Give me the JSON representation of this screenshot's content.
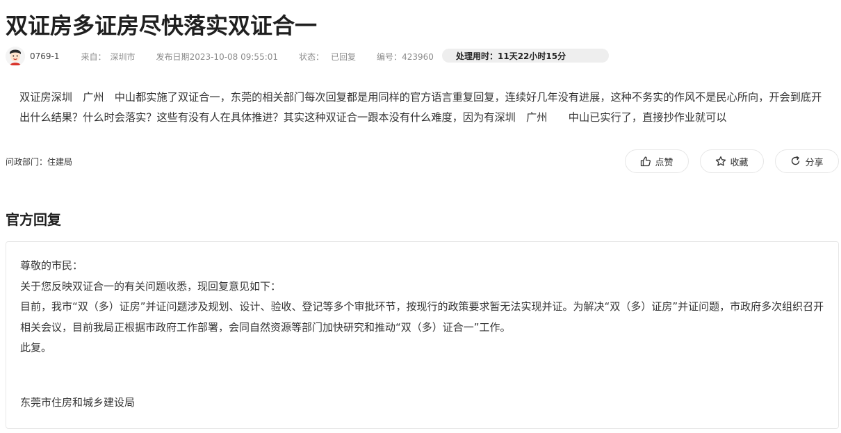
{
  "post": {
    "title": "双证房多证房尽快落实双证合一",
    "user": "0769-1",
    "source_label": "来自：",
    "source_value": "深圳市",
    "date_label": "发布日期",
    "date_value": "2023-10-08 09:55:01",
    "status_label": "状态：",
    "status_value": "已回复",
    "id_label": "编号：",
    "id_value": "423960",
    "processing_time": "处理用时：11天22小时15分",
    "content": "双证房深圳　广州　中山都实施了双证合一，东莞的相关部门每次回复都是用同样的官方语言重复回复，连续好几年没有进展，这种不务实的作风不是民心所向，开会到底开出什么结果？什么时会落实？这些有没有人在具体推进？其实这种双证合一跟本没有什么难度，因为有深圳　广州　　中山已实行了，直接抄作业就可以",
    "department": "问政部门：住建局"
  },
  "actions": {
    "like_label": "点赞",
    "favorite_label": "收藏",
    "share_label": "分享"
  },
  "reply": {
    "heading": "官方回复",
    "greeting": "尊敬的市民：",
    "intro": "关于您反映双证合一的有关问题收悉，现回复意见如下：",
    "body": "目前，我市“双（多）证房”并证问题涉及规划、设计、验收、登记等多个审批环节，按现行的政策要求暂无法实现并证。为解决“双（多）证房”并证问题，市政府多次组织召开相关会议，目前我局正根据市政府工作部署，会同自然资源等部门加快研究和推动“双（多）证合一”工作。",
    "closing": "此复。",
    "signature": "东莞市住房和城乡建设局"
  },
  "icons": {
    "avatar": "avatar-icon",
    "like": "thumbs-up-icon",
    "favorite": "star-icon",
    "share": "share-icon"
  },
  "colors": {
    "title": "#1f1f1f",
    "meta_text": "#8c8c8c",
    "badge_bg": "#eeeeee",
    "border": "#e6e6e6"
  }
}
